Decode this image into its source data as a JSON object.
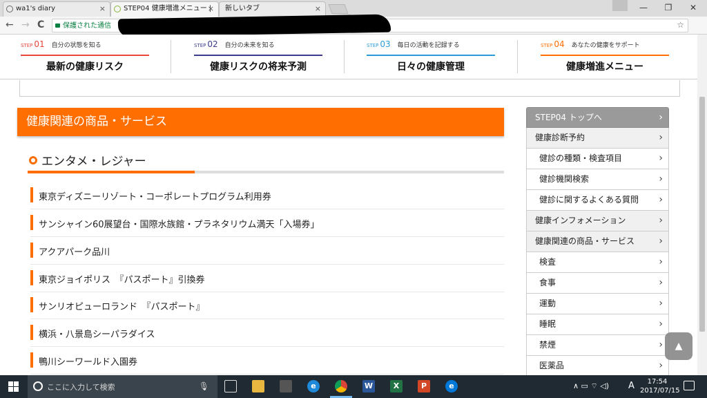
{
  "browser": {
    "tabs": [
      {
        "title": "wa1's diary",
        "close": "×"
      },
      {
        "title": "STEP04 健康増進メニュー |",
        "close": "×"
      },
      {
        "title": "新しいタブ",
        "close": "×"
      }
    ],
    "window_buttons": {
      "minimize": "—",
      "restore": "❐",
      "close": "✕"
    },
    "nav": {
      "back": "←",
      "forward": "→",
      "reload": "C"
    },
    "secure_label": "保護された通信",
    "star": "☆",
    "menu": "⋮"
  },
  "steps": [
    {
      "prefix": "STEP",
      "num": "01",
      "caption": "自分の状態を知る",
      "title": "最新の健康リスク",
      "color": "#e8453c"
    },
    {
      "prefix": "STEP",
      "num": "02",
      "caption": "自分の未来を知る",
      "title": "健康リスクの将来予測",
      "color": "#3b3b8f"
    },
    {
      "prefix": "STEP",
      "num": "03",
      "caption": "毎日の活動を記録する",
      "title": "日々の健康管理",
      "color": "#2a9bd6"
    },
    {
      "prefix": "STEP",
      "num": "04",
      "caption": "あなたの健康をサポート",
      "title": "健康増進メニュー",
      "color": "#ff6e00"
    }
  ],
  "section": {
    "title": "健康関連の商品・サービス",
    "subtitle": "エンタメ・レジャー",
    "items": [
      "東京ディズニーリゾート・コーポレートプログラム利用券",
      "サンシャイン60展望台・国際水族館・プラネタリウム満天「入場券」",
      "アクアパーク品川",
      "東京ジョイポリス　『パスポート』引換券",
      "サンリオピューロランド　『パスポート』",
      "横浜・八景島シーパラダイス",
      "鴨川シーワールド入園券"
    ]
  },
  "sidenav": [
    {
      "label": "STEP04 トップへ",
      "style": "first"
    },
    {
      "label": "健康診断予約",
      "style": "grey"
    },
    {
      "label": "健診の種類・検査項目",
      "style": "sub"
    },
    {
      "label": "健診機関検索",
      "style": "sub"
    },
    {
      "label": "健診に関するよくある質問",
      "style": "sub"
    },
    {
      "label": "健康インフォメーション",
      "style": "grey"
    },
    {
      "label": "健康関連の商品・サービス",
      "style": "grey"
    },
    {
      "label": "検査",
      "style": "sub"
    },
    {
      "label": "食事",
      "style": "sub"
    },
    {
      "label": "運動",
      "style": "sub"
    },
    {
      "label": "睡眠",
      "style": "sub"
    },
    {
      "label": "禁煙",
      "style": "sub"
    },
    {
      "label": "医薬品",
      "style": "sub"
    }
  ],
  "chevron": "›",
  "scroll_top": "▲",
  "taskbar": {
    "search_placeholder": "ここに入力して検索",
    "ime": "A",
    "time": "17:54",
    "date": "2017/07/15",
    "tray_icons": "∧ ▭ ⌔ ◁)"
  }
}
